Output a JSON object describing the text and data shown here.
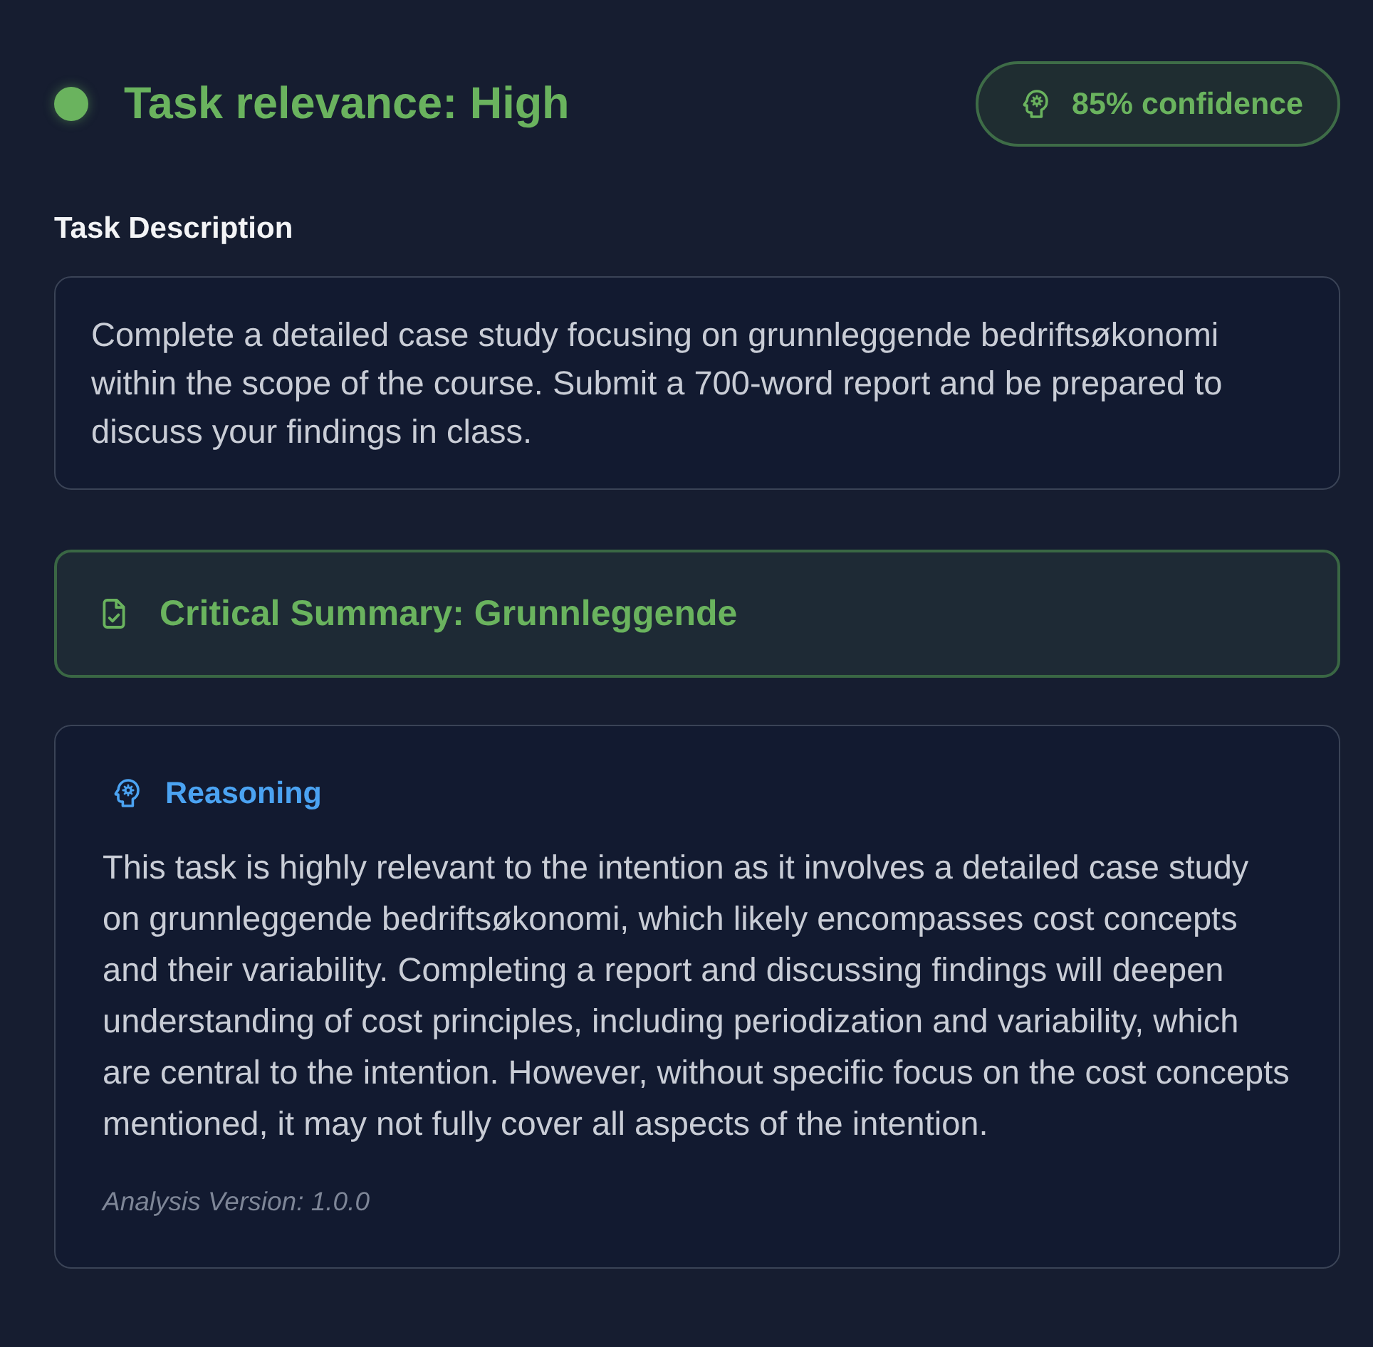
{
  "header": {
    "title": "Task relevance: High",
    "confidence_badge": {
      "label": "85% confidence"
    }
  },
  "task_description": {
    "heading": "Task Description",
    "text": "Complete a detailed case study focusing on grunnleggende bedriftsøkonomi within the scope of the course. Submit a 700-word report and be prepared to discuss your findings in class."
  },
  "critical_summary": {
    "title": "Critical Summary: Grunnleggende"
  },
  "reasoning": {
    "heading": "Reasoning",
    "text": "This task is highly relevant to the intention as it involves a detailed case study on grunnleggende bedriftsøkonomi, which likely encompasses cost concepts and their variability. Completing a report and discussing findings will deepen understanding of cost principles, including periodization and variability, which are central to the intention. However, without specific focus on the cost concepts mentioned, it may not fully cover all aspects of the intention.",
    "version": "Analysis Version: 1.0.0"
  }
}
